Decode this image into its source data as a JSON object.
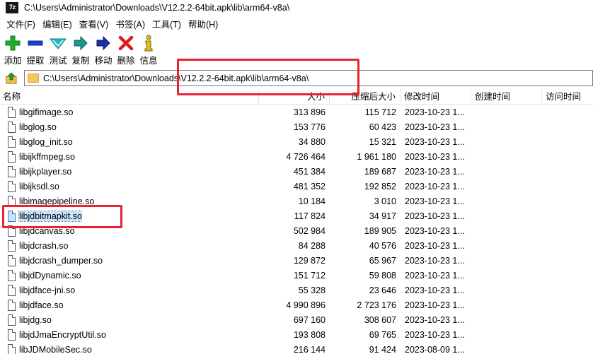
{
  "window": {
    "title": "C:\\Users\\Administrator\\Downloads\\V12.2.2-64bit.apk\\lib\\arm64-v8a\\",
    "app_icon_text": "7z"
  },
  "menu": [
    "文件(F)",
    "编辑(E)",
    "查看(V)",
    "书签(A)",
    "工具(T)",
    "帮助(H)"
  ],
  "toolbar": [
    {
      "label": "添加",
      "icon": "plus-icon",
      "color": "#1fae2b"
    },
    {
      "label": "提取",
      "icon": "minus-icon",
      "color": "#1b3fd6"
    },
    {
      "label": "测试",
      "icon": "check-icon",
      "color": "#20b8c8"
    },
    {
      "label": "复制",
      "icon": "copy-arrow-icon",
      "color": "#1a9a8a"
    },
    {
      "label": "移动",
      "icon": "move-arrow-icon",
      "color": "#1b2fa8"
    },
    {
      "label": "删除",
      "icon": "delete-x-icon",
      "color": "#e01b1b"
    },
    {
      "label": "信息",
      "icon": "info-icon",
      "color": "#d8c21a"
    }
  ],
  "address": {
    "path": "C:\\Users\\Administrator\\Downloads\\V12.2.2-64bit.apk\\lib\\arm64-v8a\\"
  },
  "columns": [
    "名称",
    "大小",
    "压缩后大小",
    "修改时间",
    "创建时间",
    "访问时间"
  ],
  "files": [
    {
      "name": "libgifimage.so",
      "size": "313 896",
      "packed": "115 712",
      "modified": "2023-10-23 1..."
    },
    {
      "name": "libglog.so",
      "size": "153 776",
      "packed": "60 423",
      "modified": "2023-10-23 1..."
    },
    {
      "name": "libglog_init.so",
      "size": "34 880",
      "packed": "15 321",
      "modified": "2023-10-23 1..."
    },
    {
      "name": "libijkffmpeg.so",
      "size": "4 726 464",
      "packed": "1 961 180",
      "modified": "2023-10-23 1..."
    },
    {
      "name": "libijkplayer.so",
      "size": "451 384",
      "packed": "189 687",
      "modified": "2023-10-23 1..."
    },
    {
      "name": "libijksdl.so",
      "size": "481 352",
      "packed": "192 852",
      "modified": "2023-10-23 1..."
    },
    {
      "name": "libimagepipeline.so",
      "size": "10 184",
      "packed": "3 010",
      "modified": "2023-10-23 1..."
    },
    {
      "name": "libjdbitmapkit.so",
      "size": "117 824",
      "packed": "34 917",
      "modified": "2023-10-23 1...",
      "selected": true
    },
    {
      "name": "libjdcanvas.so",
      "size": "502 984",
      "packed": "189 905",
      "modified": "2023-10-23 1..."
    },
    {
      "name": "libjdcrash.so",
      "size": "84 288",
      "packed": "40 576",
      "modified": "2023-10-23 1..."
    },
    {
      "name": "libjdcrash_dumper.so",
      "size": "129 872",
      "packed": "65 967",
      "modified": "2023-10-23 1..."
    },
    {
      "name": "libjdDynamic.so",
      "size": "151 712",
      "packed": "59 808",
      "modified": "2023-10-23 1..."
    },
    {
      "name": "libjdface-jni.so",
      "size": "55 328",
      "packed": "23 646",
      "modified": "2023-10-23 1..."
    },
    {
      "name": "libjdface.so",
      "size": "4 990 896",
      "packed": "2 723 176",
      "modified": "2023-10-23 1..."
    },
    {
      "name": "libjdg.so",
      "size": "697 160",
      "packed": "308 607",
      "modified": "2023-10-23 1..."
    },
    {
      "name": "libjdJmaEncryptUtil.so",
      "size": "193 808",
      "packed": "69 765",
      "modified": "2023-10-23 1..."
    },
    {
      "name": "libJDMobileSec.so",
      "size": "216 144",
      "packed": "91 424",
      "modified": "2023-08-09 1..."
    }
  ],
  "colors": {
    "highlight": "#e8232f",
    "selection": "#cce4f7"
  }
}
